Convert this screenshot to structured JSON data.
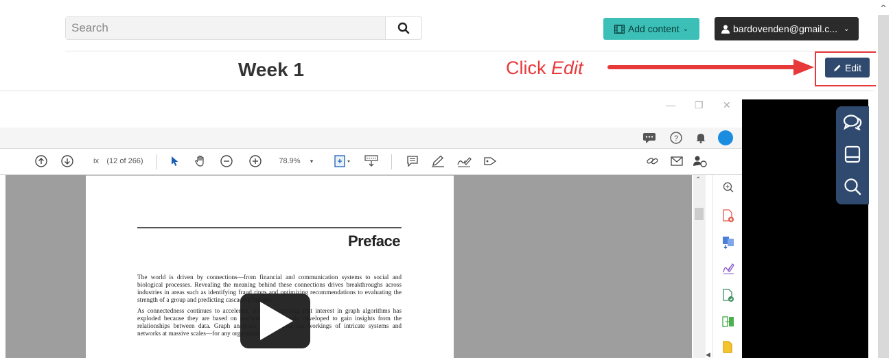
{
  "header": {
    "search_placeholder": "Search",
    "add_content_label": "Add content",
    "user_label": "bardovenden@gmail.c...",
    "page_title": "Week 1",
    "edit_label": "Edit"
  },
  "annotation": {
    "prefix": "Click ",
    "emphasis": "Edit",
    "color": "#e8393a"
  },
  "pdf_viewer": {
    "page_label": "ix",
    "page_count": "(12 of 266)",
    "zoom": "78.9%",
    "heading": "Preface",
    "paragraphs": [
      "The world is driven by connections—from financial and communication systems to social and biological processes. Revealing the meaning behind these connections drives breakthroughs across industries in areas such as identifying fraud rings and optimizing recommendations to evaluating the strength of a group and predicting cascading failures.",
      "As connectedness continues to accelerate, it's not surprising that interest in graph algorithms has exploded because they are based on mathematics explicitly developed to gain insights from the relationships between data. Graph analytics can uncover the workings of intricate systems and networks at massive scales—for any organization."
    ]
  },
  "colors": {
    "teal": "#3bbfb6",
    "navy": "#2f4a6e",
    "dark": "#2b2b2b"
  }
}
